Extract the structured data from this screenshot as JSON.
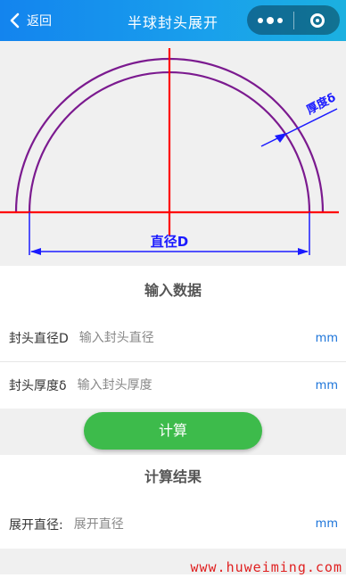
{
  "nav": {
    "back_label": "返回",
    "title": "半球封头展开",
    "back_icon": "chevron-left-icon",
    "more_icon": "more-dots-icon",
    "close_icon": "target-ring-icon"
  },
  "diagram": {
    "thickness_label": "厚度δ",
    "diameter_label": "直径D",
    "colors": {
      "shell": "#7b1a8f",
      "centerline": "#ff0000",
      "dimension": "#1a1aff"
    }
  },
  "input_section": {
    "title": "输入数据",
    "fields": [
      {
        "label": "封头直径D",
        "placeholder": "输入封头直径",
        "value": "",
        "unit": "mm"
      },
      {
        "label": "封头厚度δ",
        "placeholder": "输入封头厚度",
        "value": "",
        "unit": "mm"
      }
    ]
  },
  "calculate_label": "计算",
  "result_section": {
    "title": "计算结果",
    "fields": [
      {
        "label": "展开直径:",
        "placeholder": "展开直径",
        "value": "",
        "unit": "mm"
      }
    ]
  },
  "watermark": "www.huweiming.com",
  "colors": {
    "nav_start": "#1384ee",
    "nav_end": "#1bb0e0",
    "button": "#3dbb4b",
    "unit": "#1a73d9",
    "watermark": "#e02020"
  }
}
